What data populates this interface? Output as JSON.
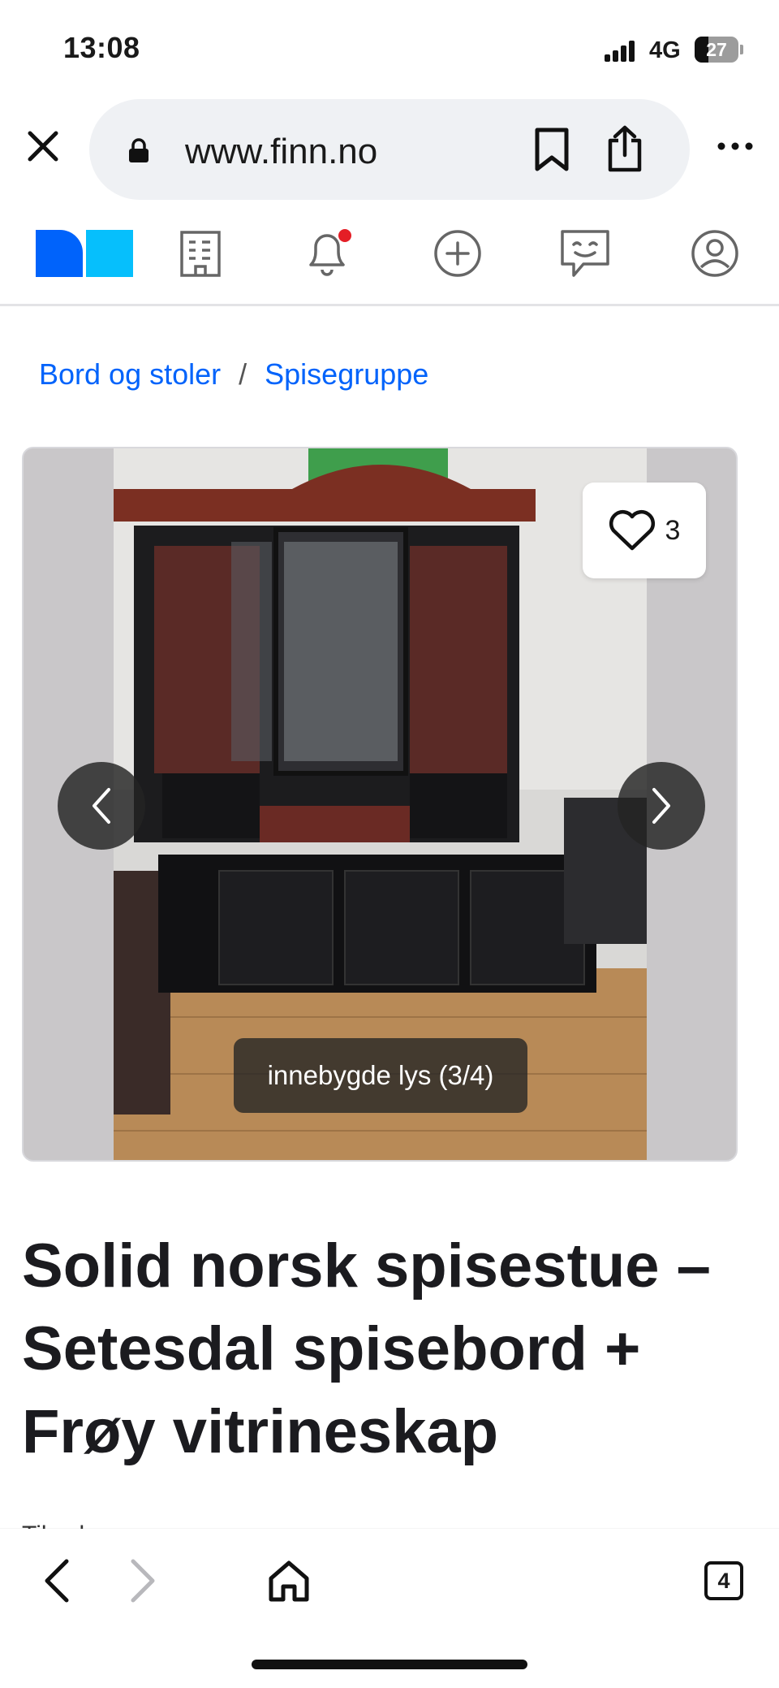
{
  "status_bar": {
    "time": "13:08",
    "network": "4G",
    "battery": "27"
  },
  "browser": {
    "url": "www.finn.no",
    "icons": {
      "close": "close-icon",
      "lock": "lock-icon",
      "bookmark": "bookmark-icon",
      "share": "share-icon",
      "more": "more-icon"
    }
  },
  "site_nav": {
    "logo": "finn-logo",
    "items": [
      "building-icon",
      "bell-icon",
      "plus-circle-icon",
      "chat-icon",
      "profile-icon"
    ],
    "notification_dot_color": "#e41e26"
  },
  "breadcrumb": {
    "items": [
      "Bord og stoler",
      "Spisegruppe"
    ],
    "separator": "/"
  },
  "gallery": {
    "favorite_count": "3",
    "caption": "innebygde lys (3/4)"
  },
  "listing": {
    "title": "Solid norsk spisestue – Setesdal spisebord + Frøy vitrineskap",
    "subtitle_peek": "Til salgs"
  },
  "toolbar": {
    "tabs_count": "4"
  },
  "colors": {
    "link": "#0063fb",
    "logo_dark_blue": "#0063fb",
    "logo_light_blue": "#06bffc"
  }
}
